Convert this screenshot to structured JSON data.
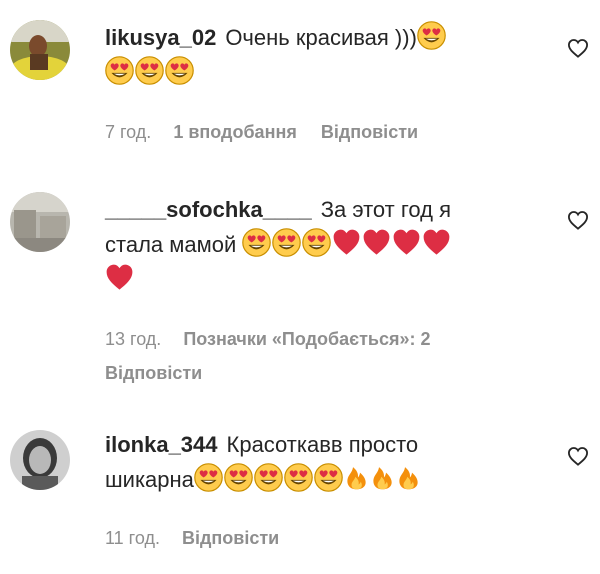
{
  "comments": [
    {
      "username": "likusya_02",
      "text": "Очень красивая )))",
      "emoji_line2": [
        "smiling-face-heart-eyes",
        "smiling-face-heart-eyes",
        "smiling-face-heart-eyes"
      ],
      "time": "7 год.",
      "likes": "1 вподобання",
      "reply": "Відповісти"
    },
    {
      "username": "_____sofochka____",
      "text": "За этот год я",
      "text2": "стала мамой",
      "emoji_line2": [
        "smiling-face-heart-eyes",
        "smiling-face-heart-eyes",
        "smiling-face-heart-eyes",
        "red-heart",
        "red-heart",
        "red-heart",
        "red-heart"
      ],
      "emoji_line3": [
        "red-heart"
      ],
      "time": "13 год.",
      "likes": "Позначки «Подобається»: 2",
      "reply": "Відповісти"
    },
    {
      "username": "ilonka_344",
      "text": "Красоткавв просто",
      "text2": "шикарна",
      "emoji_line2": [
        "smiling-face-heart-eyes",
        "smiling-face-heart-eyes",
        "smiling-face-heart-eyes",
        "smiling-face-heart-eyes",
        "smiling-face-heart-eyes",
        "fire",
        "fire",
        "fire"
      ],
      "time": "11 год.",
      "reply": "Відповісти"
    }
  ],
  "colors": {
    "text": "#262626",
    "meta": "#8e8e8e",
    "emoji_face": "#f7b500",
    "heart": "#e0245e",
    "fire": "#f4900c"
  },
  "like_icon": "heart-outline-icon"
}
